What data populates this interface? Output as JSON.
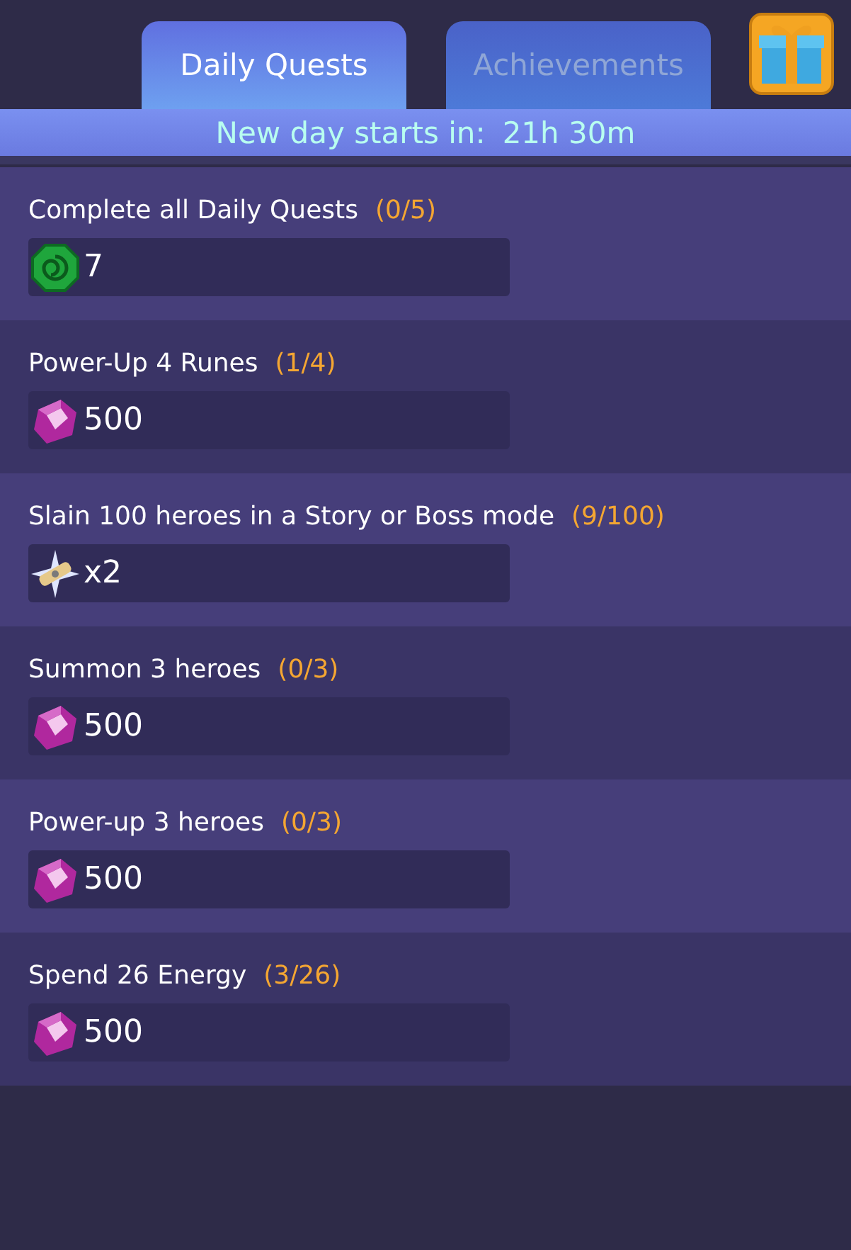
{
  "tabs": [
    {
      "label": "Daily Quests",
      "selected": true
    },
    {
      "label": "Achievements",
      "selected": false
    }
  ],
  "banner": {
    "label": "New day starts in:",
    "time": "21h 30m"
  },
  "quests": [
    {
      "title": "Complete all Daily Quests",
      "progress": "(0/5)",
      "reward": {
        "kind": "token",
        "amount": "7"
      }
    },
    {
      "title": "Power-Up 4 Runes",
      "progress": "(1/4)",
      "reward": {
        "kind": "crystal",
        "amount": "500"
      }
    },
    {
      "title": "Slain 100 heroes in a Story or Boss mode",
      "progress": "(9/100)",
      "reward": {
        "kind": "scroll",
        "amount": "x2"
      }
    },
    {
      "title": "Summon 3 heroes",
      "progress": "(0/3)",
      "reward": {
        "kind": "crystal",
        "amount": "500"
      }
    },
    {
      "title": "Power-up 3 heroes",
      "progress": "(0/3)",
      "reward": {
        "kind": "crystal",
        "amount": "500"
      }
    },
    {
      "title": "Spend 26 Energy",
      "progress": "(3/26)",
      "reward": {
        "kind": "crystal",
        "amount": "500"
      }
    }
  ]
}
